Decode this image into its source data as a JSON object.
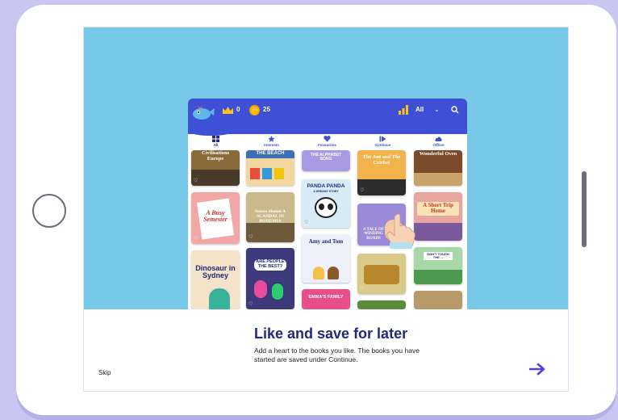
{
  "header": {
    "crown_count": "0",
    "coin_count": "25",
    "filter_label": "All"
  },
  "tabs": [
    {
      "label": "All",
      "icon": "grid-icon"
    },
    {
      "label": "Interests",
      "icon": "star-icon"
    },
    {
      "label": "Favourites",
      "icon": "heart-icon"
    },
    {
      "label": "Continue",
      "icon": "play-icon"
    },
    {
      "label": "Offline",
      "icon": "cloud-icon"
    }
  ],
  "books": {
    "civilisations": "Civilisations Europe",
    "beach": "THE BEACH",
    "alphabet": "THE ALPHABET SONG",
    "ant": "The Ant and The Cricket",
    "oven": "Wonderful Oven",
    "busy": "A Busy Semester",
    "scandal": "Sussex Homes A SCANDAL IN BOHEMIA",
    "panda": "PANDA PANDA",
    "panda_sub": "A DREAMY STORY",
    "tale": "A TALE OF WINDING ROADS",
    "trip": "A Short Trip Home",
    "dinosaur": "Dinosaur in Sydney",
    "people": "ARE PEOPLE THE BEST?",
    "amy": "Amy and Tom",
    "mini": "DON'T TOUCH THE ...",
    "emma": "EMMA'S FAMILY"
  },
  "caption": {
    "title": "Like and save for later",
    "body": "Add a heart to the books you like. The books you have started are saved under Continue.",
    "skip_label": "Skip",
    "next_icon": "arrow-right-icon"
  },
  "colors": {
    "sky": "#78c8ea",
    "app_header": "#3e50d6",
    "caption_title": "#1f2a7a",
    "arrow": "#5b3fd1"
  }
}
